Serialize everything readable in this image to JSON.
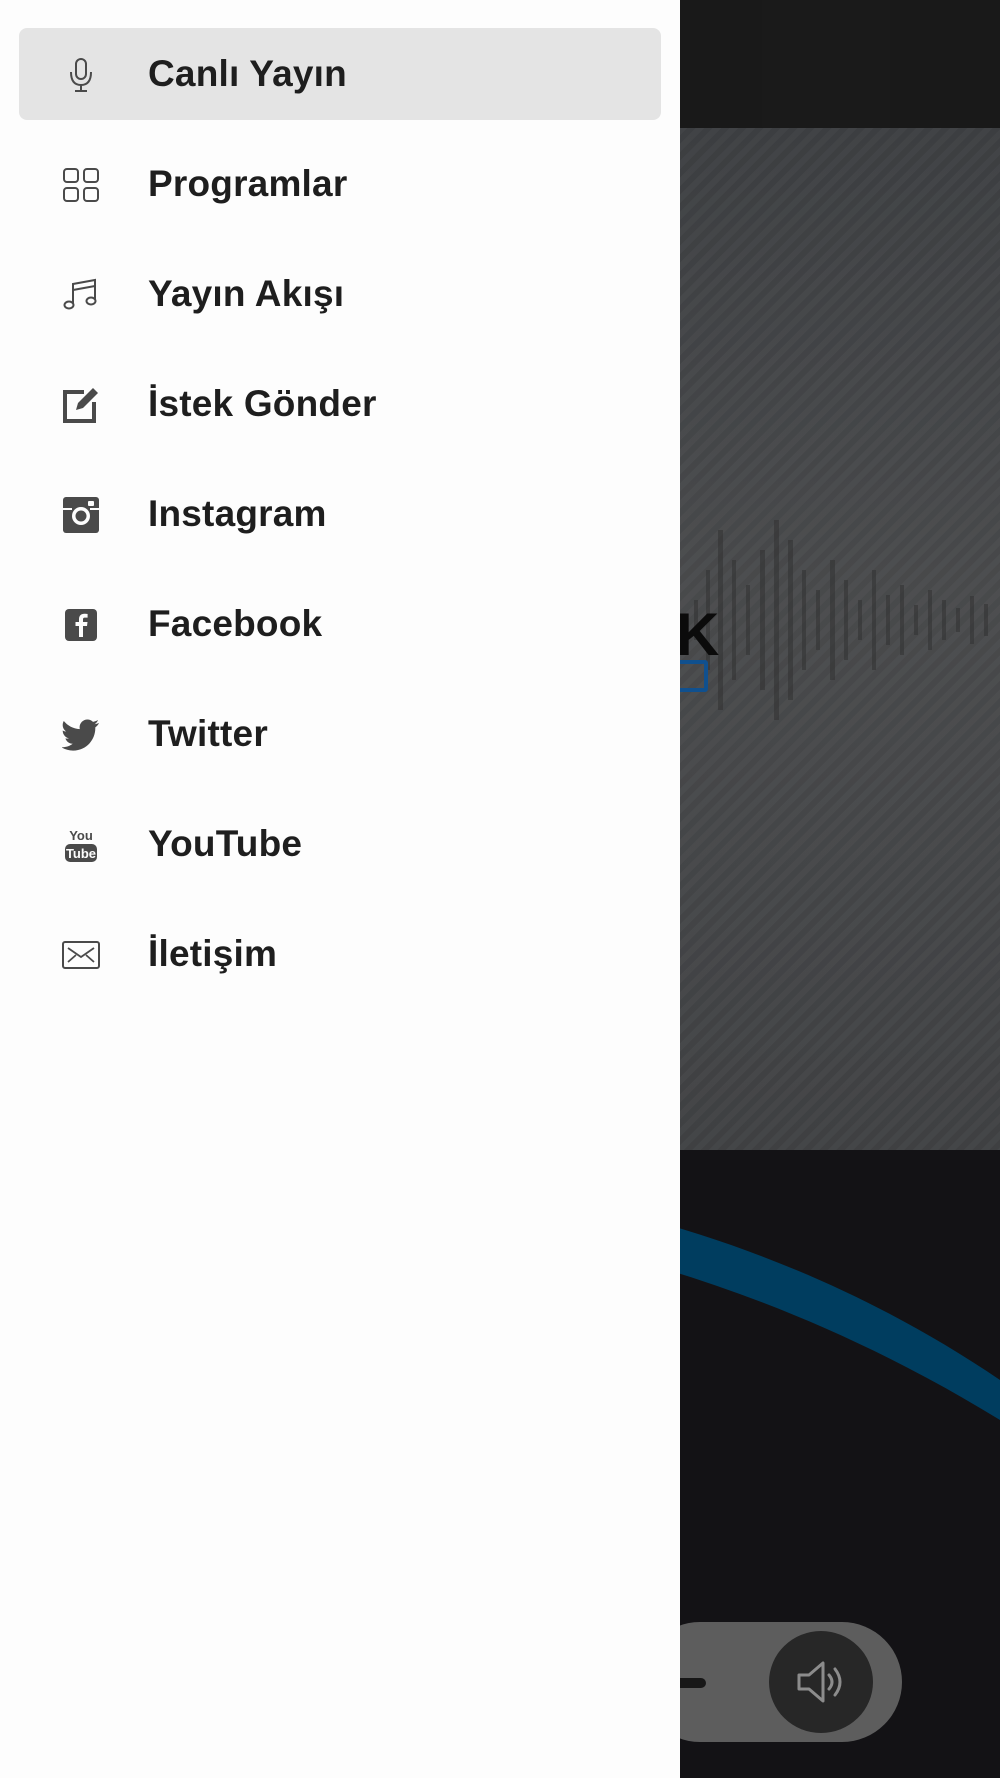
{
  "drawer": {
    "items": [
      {
        "label": "Canlı Yayın",
        "icon": "microphone-icon",
        "active": true
      },
      {
        "label": "Programlar",
        "icon": "grid-icon",
        "active": false
      },
      {
        "label": "Yayın Akışı",
        "icon": "music-note-icon",
        "active": false
      },
      {
        "label": "İstek Gönder",
        "icon": "edit-icon",
        "active": false
      },
      {
        "label": "Instagram",
        "icon": "instagram-icon",
        "active": false
      },
      {
        "label": "Facebook",
        "icon": "facebook-icon",
        "active": false
      },
      {
        "label": "Twitter",
        "icon": "twitter-icon",
        "active": false
      },
      {
        "label": "YouTube",
        "icon": "youtube-icon",
        "active": false
      },
      {
        "label": "İletişim",
        "icon": "mail-icon",
        "active": false
      }
    ]
  },
  "background": {
    "logo_fragment": "K",
    "player": {
      "volume_icon": "volume-icon"
    }
  },
  "colors": {
    "drawer_bg": "#fdfdfd",
    "active_item_bg": "#e4e4e4",
    "label_text": "#1e1e1e",
    "icon": "#4a4a4a",
    "accent_blue": "#005a8c",
    "dark_bg": "#1c1b1f"
  }
}
